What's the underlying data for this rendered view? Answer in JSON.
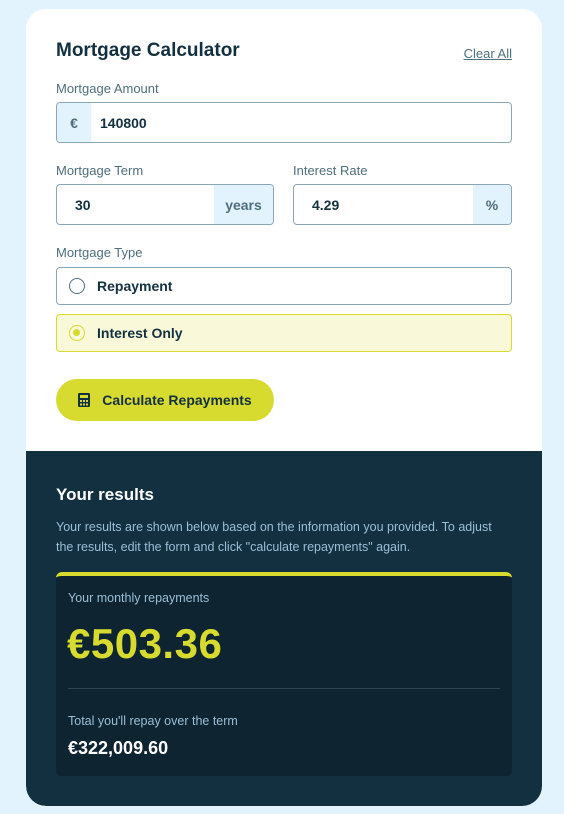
{
  "form": {
    "title": "Mortgage Calculator",
    "clear_label": "Clear All",
    "amount": {
      "label": "Mortgage Amount",
      "prefix": "€",
      "value": "140800"
    },
    "term": {
      "label": "Mortgage Term",
      "value": "30",
      "suffix": "years"
    },
    "rate": {
      "label": "Interest Rate",
      "value": "4.29",
      "suffix": "%"
    },
    "type": {
      "label": "Mortgage Type",
      "options": [
        {
          "label": "Repayment",
          "selected": false
        },
        {
          "label": "Interest Only",
          "selected": true
        }
      ]
    },
    "calculate_label": "Calculate Repayments"
  },
  "results": {
    "title": "Your results",
    "description": "Your results are shown below based on the information you provided. To adjust the results, edit the form and click \"calculate repayments\" again.",
    "monthly_label": "Your monthly repayments",
    "monthly_value": "€503.36",
    "total_label": "Total you'll repay over the term",
    "total_value": "€322,009.60"
  },
  "colors": {
    "accent": "#d8db2f",
    "dark": "#133041",
    "background": "#e3f3fd"
  },
  "icons": {
    "calculate": "calculator-icon"
  }
}
